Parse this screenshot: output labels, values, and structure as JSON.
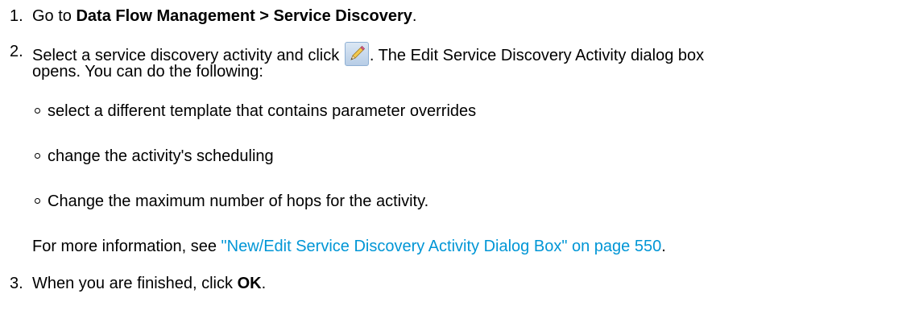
{
  "step1": {
    "number": "1.",
    "prefix": "Go to ",
    "menu_path": "Data Flow Management > Service Discovery",
    "suffix": "."
  },
  "step2": {
    "number": "2.",
    "prefix": "Select a service discovery activity and click ",
    "suffix": ". The Edit Service Discovery Activity dialog box",
    "line2": "opens. You can do the following:",
    "edit_icon": "pencil-edit-icon",
    "options": [
      "select a different template that contains parameter overrides",
      "change the activity's scheduling",
      "Change the maximum number of hops for the activity."
    ],
    "more_info_prefix": "For more information, see ",
    "more_info_link": "\"New/Edit Service Discovery Activity Dialog Box\" on page 550",
    "more_info_suffix": "."
  },
  "step3": {
    "number": "3.",
    "prefix": "When you are finished, click ",
    "button": "OK",
    "suffix": "."
  },
  "colors": {
    "text": "#000000",
    "link": "#0096d6",
    "background": "#ffffff"
  }
}
